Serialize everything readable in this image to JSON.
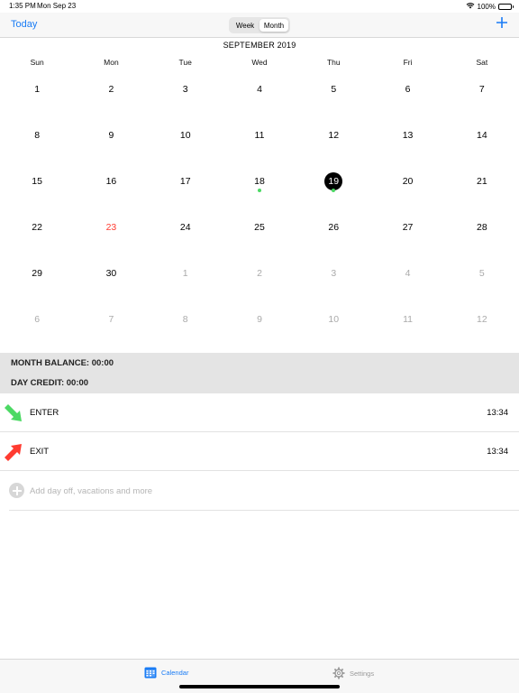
{
  "status_bar": {
    "time": "1:35 PM",
    "date": "Mon Sep 23",
    "battery": "100%",
    "wifi_icon": "wifi-icon",
    "battery_icon": "battery-icon"
  },
  "nav": {
    "today": "Today",
    "segments": [
      "Week",
      "Month"
    ],
    "selected_segment": "Month",
    "add_icon": "plus-icon",
    "accent_color": "#1a7cf5"
  },
  "calendar": {
    "month_title": "SEPTEMBER 2019",
    "weekdays": [
      "Sun",
      "Mon",
      "Tue",
      "Wed",
      "Thu",
      "Fri",
      "Sat"
    ],
    "days": [
      {
        "label": "1"
      },
      {
        "label": "2"
      },
      {
        "label": "3"
      },
      {
        "label": "4"
      },
      {
        "label": "5"
      },
      {
        "label": "6"
      },
      {
        "label": "7"
      },
      {
        "label": "8"
      },
      {
        "label": "9"
      },
      {
        "label": "10"
      },
      {
        "label": "11"
      },
      {
        "label": "12"
      },
      {
        "label": "13"
      },
      {
        "label": "14"
      },
      {
        "label": "15"
      },
      {
        "label": "16"
      },
      {
        "label": "17"
      },
      {
        "label": "18",
        "dot": true
      },
      {
        "label": "19",
        "selected": true,
        "dot": true
      },
      {
        "label": "20"
      },
      {
        "label": "21"
      },
      {
        "label": "22"
      },
      {
        "label": "23",
        "today": true
      },
      {
        "label": "24"
      },
      {
        "label": "25"
      },
      {
        "label": "26"
      },
      {
        "label": "27"
      },
      {
        "label": "28"
      },
      {
        "label": "29"
      },
      {
        "label": "30"
      },
      {
        "label": "1",
        "other": true
      },
      {
        "label": "2",
        "other": true
      },
      {
        "label": "3",
        "other": true
      },
      {
        "label": "4",
        "other": true
      },
      {
        "label": "5",
        "other": true
      },
      {
        "label": "6",
        "other": true
      },
      {
        "label": "7",
        "other": true
      },
      {
        "label": "8",
        "other": true
      },
      {
        "label": "9",
        "other": true
      },
      {
        "label": "10",
        "other": true
      },
      {
        "label": "11",
        "other": true
      },
      {
        "label": "12",
        "other": true
      }
    ],
    "today_color": "#ff3b30",
    "event_dot_color": "#4cd964"
  },
  "summary": {
    "month_balance": "MONTH BALANCE: 00:00",
    "day_credit": "DAY CREDIT: 00:00"
  },
  "entries": [
    {
      "label": "ENTER",
      "time": "13:34",
      "icon": "enter-arrow-icon",
      "color": "#4cd964"
    },
    {
      "label": "EXIT",
      "time": "13:34",
      "icon": "exit-arrow-icon",
      "color": "#ff3b30"
    }
  ],
  "add_entry": {
    "label": "Add day off, vacations and more",
    "icon": "plus-circle-icon"
  },
  "tab_bar": {
    "calendar": "Calendar",
    "settings": "Settings",
    "calendar_icon": "calendar-icon",
    "settings_icon": "gear-icon"
  }
}
